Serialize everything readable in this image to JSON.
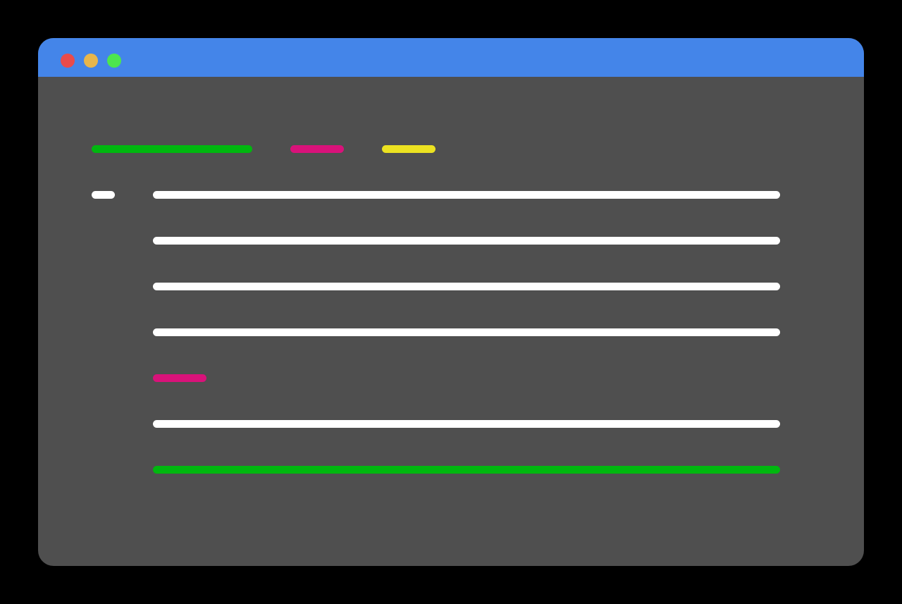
{
  "window": {
    "titlebar_color": "#4485e9",
    "background_color": "#4f4f4f",
    "controls": [
      {
        "name": "close",
        "color": "#e94b4b"
      },
      {
        "name": "minimize",
        "color": "#e8b64c"
      },
      {
        "name": "zoom",
        "color": "#4de64e"
      }
    ]
  },
  "code": {
    "header_tokens": [
      {
        "color": "#00b70f"
      },
      {
        "color": "#d9127a"
      },
      {
        "color": "#ece221"
      }
    ],
    "gutter_color": "#ffffff",
    "lines": [
      {
        "color": "#ffffff"
      },
      {
        "color": "#ffffff"
      },
      {
        "color": "#ffffff"
      },
      {
        "color": "#ffffff"
      },
      {
        "color": "#d9127a"
      },
      {
        "color": "#ffffff"
      },
      {
        "color": "#00b70f"
      }
    ]
  }
}
